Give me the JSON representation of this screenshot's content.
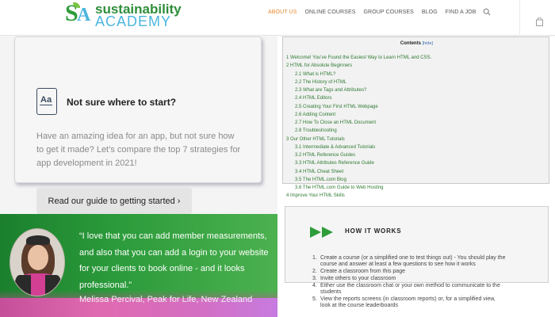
{
  "header": {
    "logo_line1": "sustainability",
    "logo_line2": "ACADEMY",
    "logo_mark_s": "S",
    "logo_mark_a": "A",
    "nav": [
      "ABOUT US",
      "ONLINE COURSES",
      "GROUP COURSES",
      "BLOG",
      "FIND A JOB"
    ],
    "accent": "#e6892f"
  },
  "card": {
    "icon_text": "Aa",
    "title": "Not sure where to start?",
    "body": "Have an amazing idea for an app, but not sure how to get it made? Let’s compare the top 7 strategies for app development in 2021!",
    "button": "Read our guide to getting started ›"
  },
  "testimonial": {
    "quote": "“I love that you can add member measurements, and also that you can add a login to your website for your clients to book online - and it looks professional.”",
    "author": "Melissa Percival, Peak for Life, New Zealand"
  },
  "toc": {
    "title": "Contents",
    "hide": "[hide]",
    "items": [
      {
        "text": "1 Welcome! You’ve Found the Easiest Way to Learn HTML and CSS.",
        "sub": false
      },
      {
        "text": "2 HTML for Absolute Beginners",
        "sub": false
      },
      {
        "text": "2.1 What is HTML?",
        "sub": true
      },
      {
        "text": "2.2 The History of HTML",
        "sub": true
      },
      {
        "text": "2.3 What are Tags and Attributes?",
        "sub": true
      },
      {
        "text": "2.4 HTML Editors",
        "sub": true
      },
      {
        "text": "2.5 Creating Your First HTML Webpage",
        "sub": true
      },
      {
        "text": "2.6 Adding Content",
        "sub": true
      },
      {
        "text": "2.7 How To Close an HTML Document",
        "sub": true
      },
      {
        "text": "2.8 Troubleshooting",
        "sub": true
      },
      {
        "text": "3 Our Other HTML Tutorials",
        "sub": false
      },
      {
        "text": "3.1 Intermediate & Advanced Tutorials",
        "sub": true
      },
      {
        "text": "3.2 HTML Reference Guides",
        "sub": true
      },
      {
        "text": "3.3 HTML Attributes Reference Guide",
        "sub": true
      },
      {
        "text": "3.4 HTML Cheat Sheet",
        "sub": true
      },
      {
        "text": "3.5 The HTML.com Blog",
        "sub": true
      },
      {
        "text": "3.6 The HTML.com Guide to Web Hosting",
        "sub": true
      },
      {
        "text": "4 Improve Your HTML Skills",
        "sub": false
      }
    ]
  },
  "how": {
    "title": "HOW IT WORKS",
    "arrow_color": "#2e9d3a",
    "steps": [
      {
        "num": "1.",
        "lines": [
          "Create a course (or a simplified one to test things out) - You should play the",
          "course and answer at least a few questions to see how it works"
        ]
      },
      {
        "num": "2.",
        "lines": [
          "Create a classroom from this page"
        ]
      },
      {
        "num": "3.",
        "lines": [
          "Invite others to your classroom"
        ]
      },
      {
        "num": "4.",
        "lines": [
          "Either use the classroom chat or your own method to communicate to the",
          "students"
        ]
      },
      {
        "num": "5.",
        "lines": [
          "View the reports screens (in classroom reports) or, for a simplified view,",
          "look at the course leaderboards"
        ]
      }
    ]
  }
}
